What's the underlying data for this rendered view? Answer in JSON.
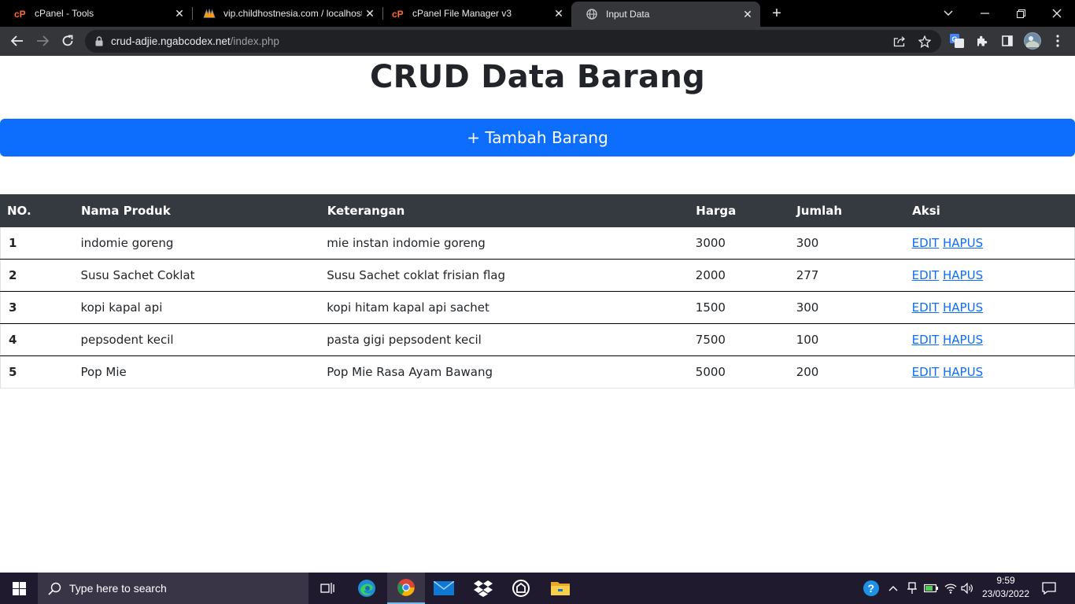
{
  "browser": {
    "tabs": [
      {
        "title": "cPanel - Tools",
        "favicon": "cpanel-icon"
      },
      {
        "title": "vip.childhostnesia.com / localhost",
        "favicon": "phpmyadmin-icon"
      },
      {
        "title": "cPanel File Manager v3",
        "favicon": "cpanel-icon"
      },
      {
        "title": "Input Data",
        "favicon": "globe-icon",
        "active": true
      }
    ],
    "url_host": "crud-adjie.ngabcodex.net",
    "url_path": "/index.php"
  },
  "page": {
    "title": "CRUD Data Barang",
    "add_button": "+ Tambah Barang",
    "table": {
      "headers": [
        "NO.",
        "Nama Produk",
        "Keterangan",
        "Harga",
        "Jumlah",
        "Aksi"
      ],
      "rows": [
        {
          "no": "1",
          "nama": "indomie goreng",
          "keterangan": "mie instan indomie goreng",
          "harga": "3000",
          "jumlah": "300"
        },
        {
          "no": "2",
          "nama": "Susu Sachet Coklat",
          "keterangan": "Susu Sachet coklat frisian flag",
          "harga": "2000",
          "jumlah": "277"
        },
        {
          "no": "3",
          "nama": "kopi kapal api",
          "keterangan": "kopi hitam kapal api sachet",
          "harga": "1500",
          "jumlah": "300"
        },
        {
          "no": "4",
          "nama": "pepsodent kecil",
          "keterangan": "pasta gigi pepsodent kecil",
          "harga": "7500",
          "jumlah": "100"
        },
        {
          "no": "5",
          "nama": "Pop Mie",
          "keterangan": "Pop Mie Rasa Ayam Bawang",
          "harga": "5000",
          "jumlah": "200"
        }
      ],
      "edit_label": "EDIT",
      "delete_label": "HAPUS"
    }
  },
  "taskbar": {
    "search_placeholder": "Type here to search",
    "time": "9:59",
    "date": "23/03/2022"
  },
  "colors": {
    "primary": "#0d6efd",
    "table_header": "#343a40",
    "taskbar": "#1f1a2e"
  }
}
